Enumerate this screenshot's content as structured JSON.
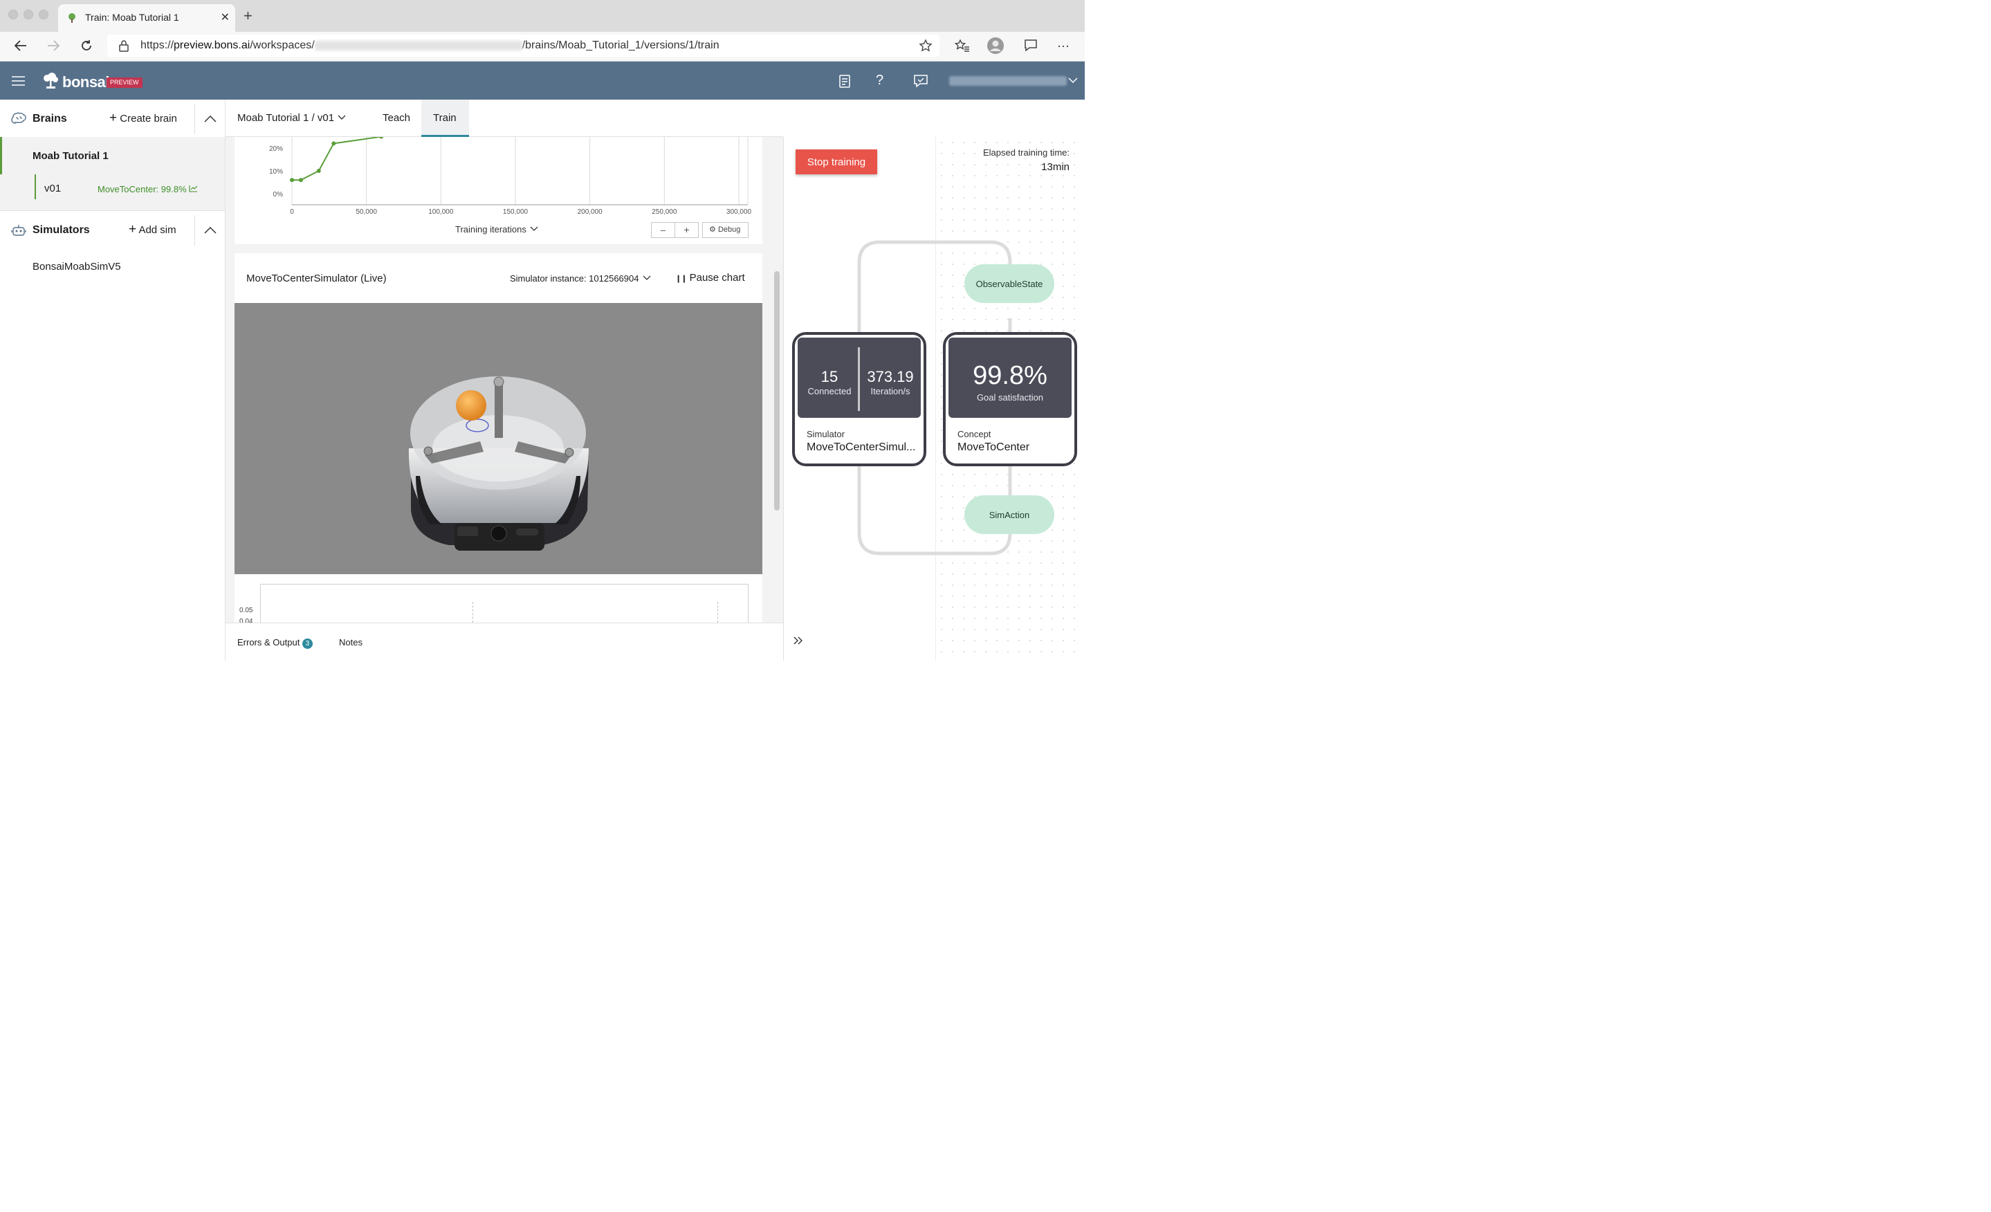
{
  "browser": {
    "tab_title": "Train: Moab Tutorial 1",
    "url_prefix": "https://",
    "url_host": "preview.bons.ai",
    "url_path1": "/workspaces/",
    "url_path2": "/brains/Moab_Tutorial_1/versions/1/train"
  },
  "header": {
    "brand": "bonsai",
    "badge": "PREVIEW"
  },
  "sidebar": {
    "brains_label": "Brains",
    "create_brain": "Create brain",
    "brain_name": "Moab Tutorial 1",
    "version": "v01",
    "version_status": "MoveToCenter: 99.8%",
    "simulators_label": "Simulators",
    "add_sim": "Add sim",
    "simulator_name": "BonsaiMoabSimV5"
  },
  "topnav": {
    "breadcrumb": "Moab Tutorial 1 / v01",
    "tabs": [
      "Teach",
      "Train"
    ],
    "active_tab": "Train"
  },
  "training_chart": {
    "x_axis_label": "Training iterations",
    "debug_label": "Debug",
    "zoom_out": "–",
    "zoom_in": "+"
  },
  "chart_data": {
    "type": "line",
    "xlabel": "Training iterations",
    "ylabel": "",
    "x_ticks": [
      "0",
      "50,000",
      "100,000",
      "150,000",
      "200,000",
      "250,000",
      "300,000"
    ],
    "y_ticks": [
      "0%",
      "10%",
      "20%"
    ],
    "xlim": [
      0,
      300000
    ],
    "ylim_visible": [
      0,
      25
    ],
    "series": [
      {
        "x": [
          0,
          6000,
          18000,
          28000,
          60000
        ],
        "y": [
          6,
          6,
          10,
          22,
          25
        ]
      }
    ],
    "color": "#5a9e3a"
  },
  "sim_card": {
    "title": "MoveToCenterSimulator (Live)",
    "instance_label": "Simulator instance: 1012566904",
    "pause_label": "Pause chart",
    "mini_ticks": [
      "0.05",
      "0.04"
    ]
  },
  "bottom": {
    "errors_label": "Errors & Output",
    "errors_count": "3",
    "notes_label": "Notes"
  },
  "graph": {
    "stop_label": "Stop training",
    "elapsed_label": "Elapsed training time:",
    "elapsed_value": "13min",
    "sim_connected_value": "15",
    "sim_connected_label": "Connected",
    "sim_iter_value": "373.19",
    "sim_iter_label": "Iteration/s",
    "sim_type": "Simulator",
    "sim_name": "MoveToCenterSimul...",
    "concept_value": "99.8%",
    "concept_label": "Goal satisfaction",
    "concept_type": "Concept",
    "concept_name": "MoveToCenter",
    "observable": "ObservableState",
    "action": "SimAction"
  },
  "colors": {
    "header_bg": "#56708a",
    "accent_green": "#5a9e3a",
    "stop_red": "#e8544a",
    "tab_underline": "#2e8a9e",
    "node_dark": "#4c4c59",
    "pill_green": "#c7ead8",
    "badge": "#c4344f"
  }
}
